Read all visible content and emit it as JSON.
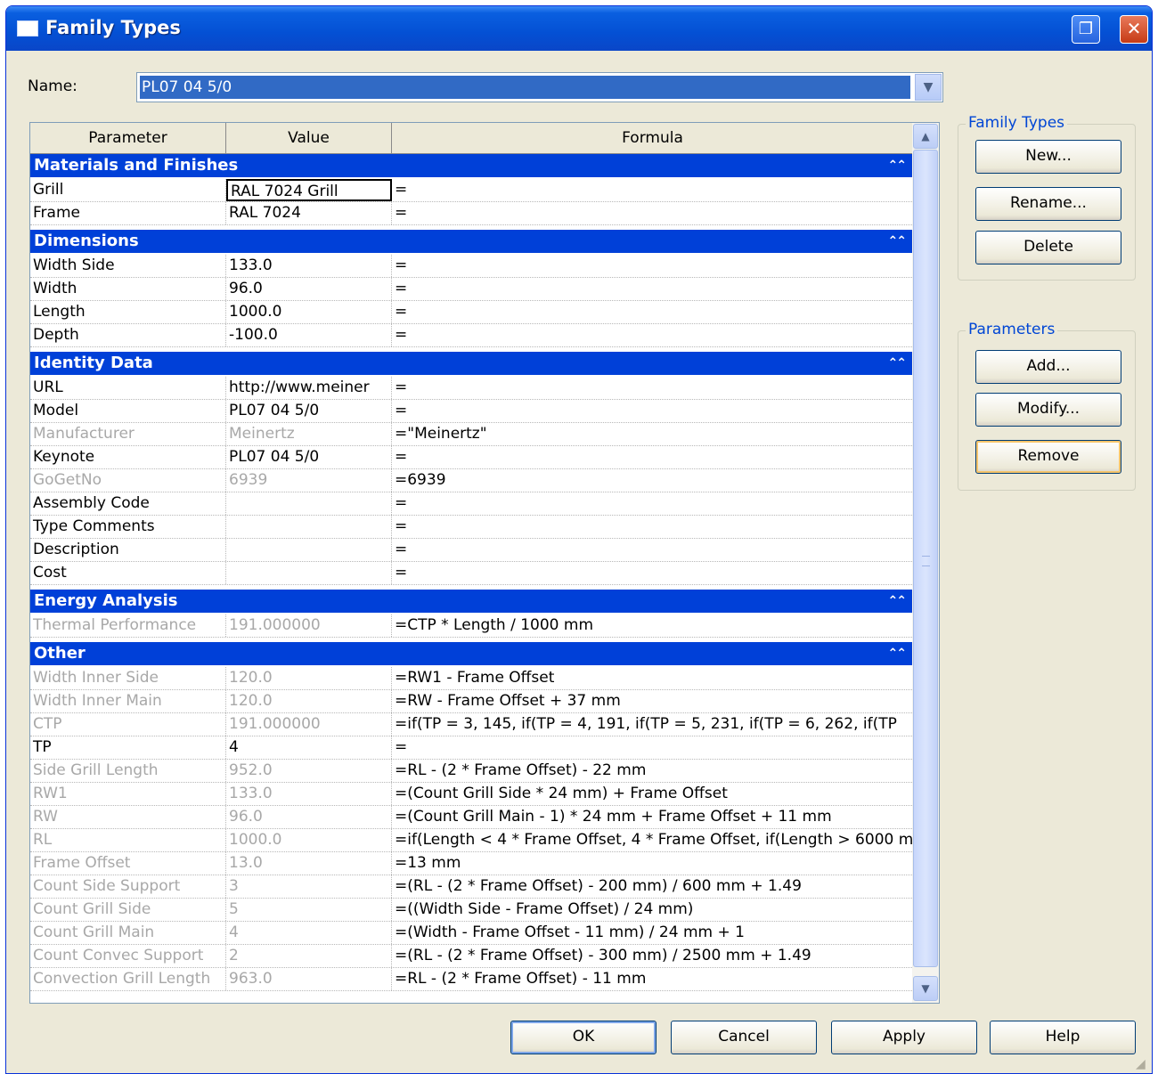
{
  "window": {
    "title": "Family Types"
  },
  "name_field": {
    "label": "Name:",
    "value": "PL07 04 5/0"
  },
  "table": {
    "headers": [
      "Parameter",
      "Value",
      "Formula"
    ],
    "groups": [
      {
        "title": "Materials and Finishes",
        "rows": [
          {
            "param": "Grill",
            "value": "RAL 7024 Grill",
            "formula": "=",
            "dim": false,
            "selected": true
          },
          {
            "param": "Frame",
            "value": "RAL 7024",
            "formula": "=",
            "dim": false
          }
        ]
      },
      {
        "title": "Dimensions",
        "rows": [
          {
            "param": "Width Side",
            "value": "133.0",
            "formula": "=",
            "dim": false
          },
          {
            "param": "Width",
            "value": "96.0",
            "formula": "=",
            "dim": false
          },
          {
            "param": "Length",
            "value": "1000.0",
            "formula": "=",
            "dim": false
          },
          {
            "param": "Depth",
            "value": "-100.0",
            "formula": "=",
            "dim": false
          }
        ]
      },
      {
        "title": "Identity Data",
        "rows": [
          {
            "param": "URL",
            "value": "http://www.meiner",
            "formula": "=",
            "dim": false
          },
          {
            "param": "Model",
            "value": "PL07 04 5/0",
            "formula": "=",
            "dim": false
          },
          {
            "param": "Manufacturer",
            "value": "Meinertz",
            "formula": "=\"Meinertz\"",
            "dim": true
          },
          {
            "param": "Keynote",
            "value": "PL07 04 5/0",
            "formula": "=",
            "dim": false
          },
          {
            "param": "GoGetNo",
            "value": "6939",
            "formula": "=6939",
            "dim": true
          },
          {
            "param": "Assembly Code",
            "value": "",
            "formula": "=",
            "dim": false
          },
          {
            "param": "Type Comments",
            "value": "",
            "formula": "=",
            "dim": false
          },
          {
            "param": "Description",
            "value": "",
            "formula": "=",
            "dim": false
          },
          {
            "param": "Cost",
            "value": "",
            "formula": "=",
            "dim": false
          }
        ]
      },
      {
        "title": "Energy Analysis",
        "rows": [
          {
            "param": "Thermal Performance",
            "value": "191.000000",
            "formula": "=CTP * Length / 1000 mm",
            "dim": true
          }
        ]
      },
      {
        "title": "Other",
        "rows": [
          {
            "param": "Width Inner Side",
            "value": "120.0",
            "formula": "=RW1 - Frame Offset",
            "dim": true
          },
          {
            "param": "Width Inner Main",
            "value": "120.0",
            "formula": "=RW - Frame Offset + 37 mm",
            "dim": true
          },
          {
            "param": "CTP",
            "value": "191.000000",
            "formula": "=if(TP = 3, 145, if(TP = 4, 191, if(TP = 5, 231, if(TP = 6, 262, if(TP",
            "dim": true
          },
          {
            "param": "TP",
            "value": "4",
            "formula": "=",
            "dim": false
          },
          {
            "param": "Side Grill Length",
            "value": "952.0",
            "formula": "=RL - (2 * Frame Offset) - 22 mm",
            "dim": true
          },
          {
            "param": "RW1",
            "value": "133.0",
            "formula": "=(Count Grill Side * 24 mm) + Frame Offset",
            "dim": true
          },
          {
            "param": "RW",
            "value": "96.0",
            "formula": "=(Count Grill Main - 1) * 24 mm + Frame Offset + 11 mm",
            "dim": true
          },
          {
            "param": "RL",
            "value": "1000.0",
            "formula": "=if(Length < 4 * Frame Offset, 4 * Frame Offset, if(Length > 6000 m",
            "dim": true
          },
          {
            "param": "Frame Offset",
            "value": "13.0",
            "formula": "=13 mm",
            "dim": true
          },
          {
            "param": "Count Side Support",
            "value": "3",
            "formula": "=(RL - (2 * Frame Offset) - 200 mm) / 600 mm + 1.49",
            "dim": true
          },
          {
            "param": "Count Grill Side",
            "value": "5",
            "formula": "=((Width Side - Frame Offset) / 24 mm)",
            "dim": true
          },
          {
            "param": "Count Grill Main",
            "value": "4",
            "formula": "=(Width - Frame Offset - 11 mm) / 24 mm + 1",
            "dim": true
          },
          {
            "param": "Count Convec Support",
            "value": "2",
            "formula": "=(RL - (2 * Frame Offset) - 300 mm) / 2500 mm + 1.49",
            "dim": true
          },
          {
            "param": "Convection Grill Length",
            "value": "963.0",
            "formula": "=RL - (2 * Frame Offset) - 11 mm",
            "dim": true
          }
        ]
      }
    ]
  },
  "family_types_group": {
    "title": "Family Types",
    "new_label": "New...",
    "rename_label": "Rename...",
    "delete_label": "Delete"
  },
  "parameters_group": {
    "title": "Parameters",
    "add_label": "Add...",
    "modify_label": "Modify...",
    "remove_label": "Remove"
  },
  "footer": {
    "ok_label": "OK",
    "cancel_label": "Cancel",
    "apply_label": "Apply",
    "help_label": "Help"
  },
  "icons": {
    "collapse": "double-chevron-up-icon",
    "combo": "chevron-down-icon",
    "close": "close-icon",
    "restore": "restore-icon"
  },
  "colors": {
    "group_header": "#0040d8",
    "title_bar": "#0450d4",
    "dialog_bg": "#ECE9D8",
    "selection": "#316ac5"
  }
}
